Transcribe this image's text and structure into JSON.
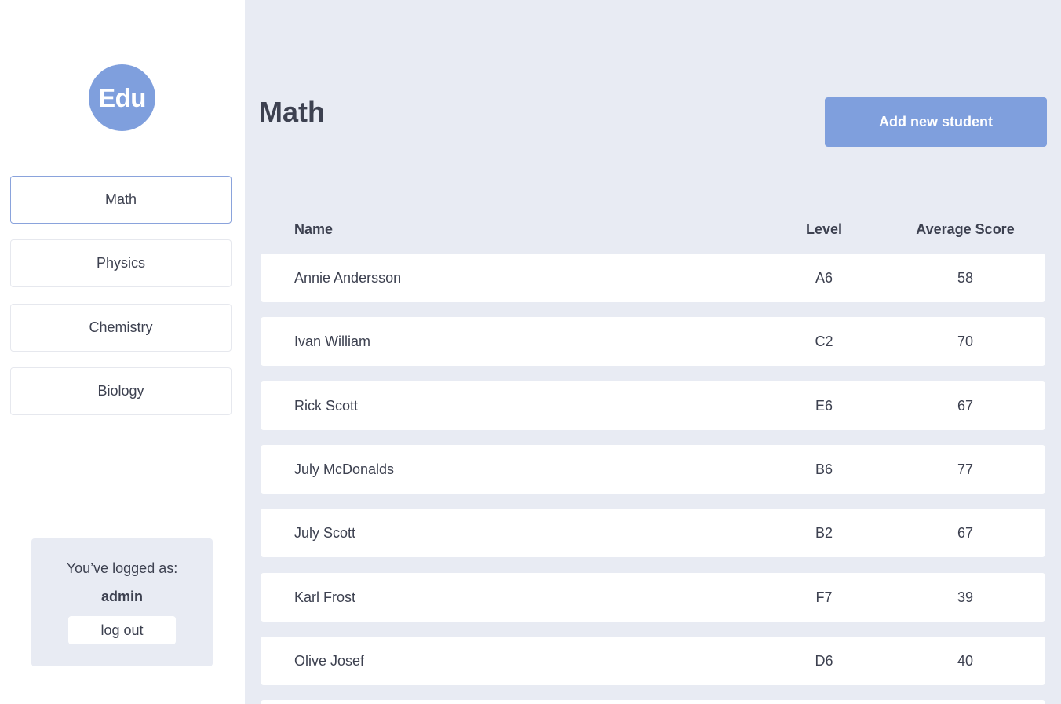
{
  "logo": {
    "text": "Edu"
  },
  "sidebar": {
    "items": [
      {
        "label": "Math",
        "active": true
      },
      {
        "label": "Physics"
      },
      {
        "label": "Chemistry"
      },
      {
        "label": "Biology"
      }
    ]
  },
  "user": {
    "label": "You’ve logged as:",
    "username": "admin",
    "logout_label": "log out"
  },
  "main": {
    "title": "Math",
    "add_button_label": "Add new student",
    "columns": {
      "name": "Name",
      "level": "Level",
      "score": "Average Score"
    },
    "rows": [
      {
        "name": "Annie Andersson",
        "level": "A6",
        "score": "58"
      },
      {
        "name": "Ivan William",
        "level": "C2",
        "score": "70"
      },
      {
        "name": "Rick Scott",
        "level": "E6",
        "score": "67"
      },
      {
        "name": "July McDonalds",
        "level": "B6",
        "score": "77"
      },
      {
        "name": "July Scott",
        "level": "B2",
        "score": "67"
      },
      {
        "name": "Karl Frost",
        "level": "F7",
        "score": "39"
      },
      {
        "name": "Olive Josef",
        "level": "D6",
        "score": "40"
      }
    ]
  },
  "colors": {
    "accent": "#7f9fdd",
    "background": "#e8ebf3",
    "text": "#3d4150"
  }
}
